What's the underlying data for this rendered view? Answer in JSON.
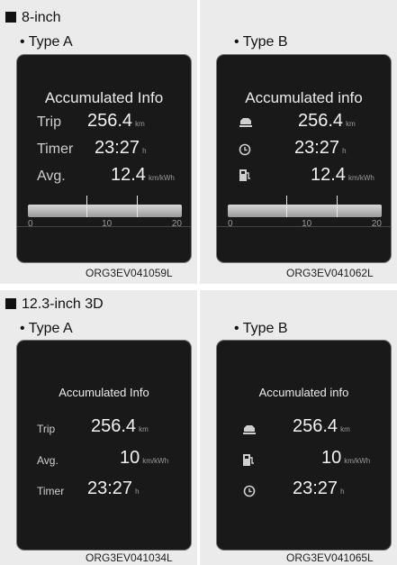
{
  "sections": [
    {
      "title": "8-inch"
    },
    {
      "title": "12.3-inch 3D"
    }
  ],
  "panels": {
    "p1": {
      "type_label": "• Type A",
      "code": "ORG3EV041059L",
      "screen_title": "Accumulated Info",
      "rows": [
        {
          "label": "Trip",
          "value": "256.4",
          "unit": "km"
        },
        {
          "label": "Timer",
          "value": "23:27",
          "unit": "h"
        },
        {
          "label": "Avg.",
          "value": "12.4",
          "unit": "km/kWh"
        }
      ],
      "scale": [
        "0",
        "10",
        "20"
      ]
    },
    "p2": {
      "type_label": "• Type B",
      "code": "ORG3EV041062L",
      "screen_title": "Accumulated info",
      "rows": [
        {
          "icon": "car-trip-icon",
          "value": "256.4",
          "unit": "km"
        },
        {
          "icon": "clock-icon",
          "value": "23:27",
          "unit": "h"
        },
        {
          "icon": "charging-station-icon",
          "value": "12.4",
          "unit": "km/kWh"
        }
      ],
      "scale": [
        "0",
        "10",
        "20"
      ]
    },
    "p3": {
      "type_label": "• Type A",
      "code": "ORG3EV041034L",
      "screen_title": "Accumulated Info",
      "rows": [
        {
          "label": "Trip",
          "value": "256.4",
          "unit": "km"
        },
        {
          "label": "Avg.",
          "value": "10",
          "unit": "km/kWh"
        },
        {
          "label": "Timer",
          "value": "23:27",
          "unit": "h"
        }
      ]
    },
    "p4": {
      "type_label": "• Type B",
      "code": "ORG3EV041065L",
      "screen_title": "Accumulated info",
      "rows": [
        {
          "icon": "car-trip-icon",
          "value": "256.4",
          "unit": "km"
        },
        {
          "icon": "charging-station-icon",
          "value": "10",
          "unit": "km/kWh"
        },
        {
          "icon": "clock-icon",
          "value": "23:27",
          "unit": "h"
        }
      ]
    }
  }
}
